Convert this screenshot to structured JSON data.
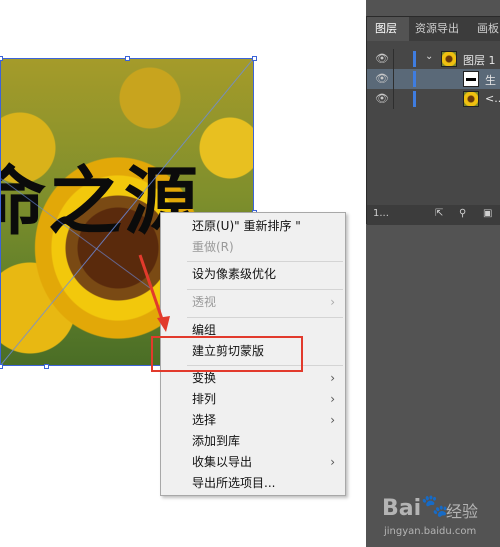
{
  "artwork": {
    "text": "命之源"
  },
  "layers_panel": {
    "tabs": [
      "图层",
      "资源导出",
      "画板"
    ],
    "layers": [
      {
        "label": "图层 1",
        "thumb": "sunflower"
      },
      {
        "label": "生",
        "thumb": "text"
      },
      {
        "label": "<...",
        "thumb": "sunflower"
      }
    ],
    "footer_left": "1..."
  },
  "context_menu": {
    "items": [
      {
        "label": "还原(U)\" 重新排序 \"",
        "enabled": true,
        "submenu": false
      },
      {
        "label": "重做(R)",
        "enabled": false,
        "submenu": false
      },
      {
        "label": "设为像素级优化",
        "enabled": true,
        "submenu": false
      },
      {
        "label": "透视",
        "enabled": false,
        "submenu": true
      },
      {
        "label": "编组",
        "enabled": true,
        "submenu": false
      },
      {
        "label": "建立剪切蒙版",
        "enabled": true,
        "submenu": false,
        "highlighted": true
      },
      {
        "label": "变换",
        "enabled": true,
        "submenu": true
      },
      {
        "label": "排列",
        "enabled": true,
        "submenu": true
      },
      {
        "label": "选择",
        "enabled": true,
        "submenu": true
      },
      {
        "label": "添加到库",
        "enabled": true,
        "submenu": false
      },
      {
        "label": "收集以导出",
        "enabled": true,
        "submenu": true
      },
      {
        "label": "导出所选项目...",
        "enabled": true,
        "submenu": false
      }
    ]
  },
  "watermark": {
    "brand": "Bai",
    "brand_suffix": "经验",
    "url": "jingyan.baidu.com"
  },
  "colors": {
    "highlight_box": "#e23a2c",
    "selection": "#3c64d8",
    "panel_bg": "#535353"
  }
}
